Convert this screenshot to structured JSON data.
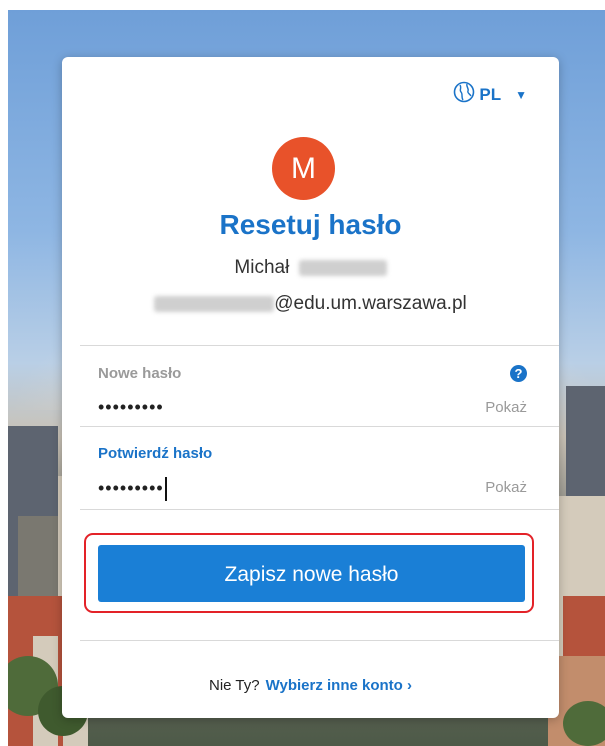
{
  "language": {
    "code": "PL",
    "icon": "globe-icon",
    "caret_icon": "caret-down-icon"
  },
  "avatar": {
    "initial": "M",
    "color": "#e8522a"
  },
  "title": "Resetuj hasło",
  "user": {
    "first_name": "Michał",
    "email_domain": "@edu.um.warszawa.pl"
  },
  "new_password": {
    "label": "Nowe hasło",
    "value": "•••••••••",
    "show_label": "Pokaż",
    "help_icon": "?"
  },
  "confirm_password": {
    "label": "Potwierdź hasło",
    "value": "•••••••••",
    "show_label": "Pokaż"
  },
  "save_button": {
    "label": "Zapisz nowe hasło",
    "color": "#1a7fd6",
    "highlight_color": "#e32228"
  },
  "footer": {
    "prompt": "Nie Ty?",
    "link": "Wybierz inne konto ›"
  },
  "colors": {
    "accent": "#1a73c8"
  }
}
